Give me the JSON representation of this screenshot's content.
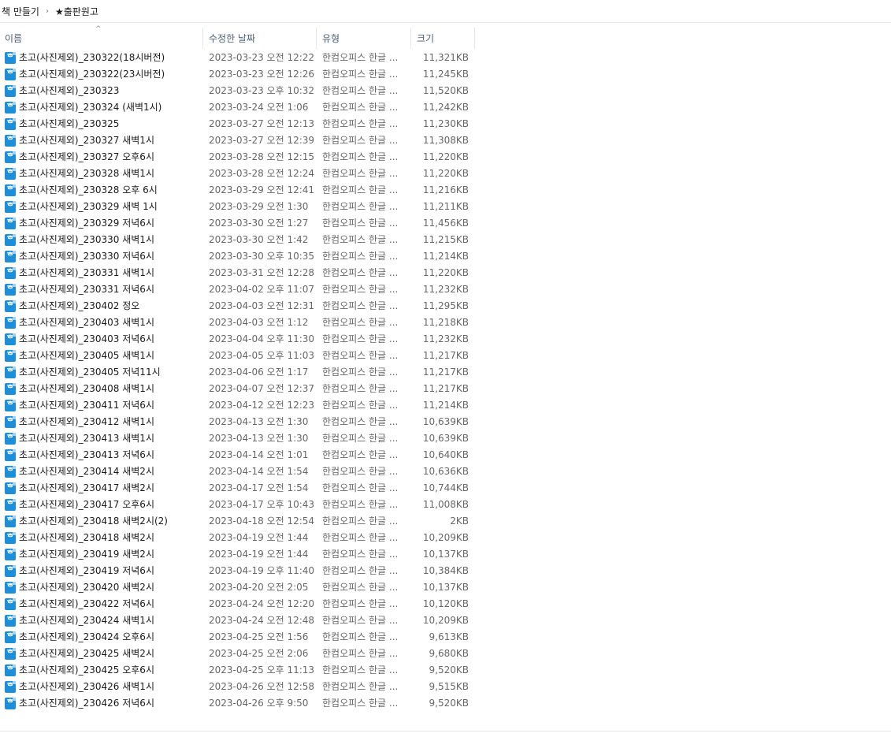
{
  "breadcrumb": {
    "items": [
      "책 만들기",
      "★출판원고"
    ],
    "separator": "›"
  },
  "header": {
    "sort_caret": "^",
    "columns": [
      "이름",
      "수정한 날짜",
      "유형",
      "크기"
    ]
  },
  "files": [
    {
      "name": "초고(사진제외)_230322(18시버전)",
      "date": "2023-03-23 오전 12:22",
      "type": "한컴오피스 한글 ...",
      "size": "11,321KB"
    },
    {
      "name": "초고(사진제외)_230322(23시버전)",
      "date": "2023-03-23 오전 12:26",
      "type": "한컴오피스 한글 ...",
      "size": "11,245KB"
    },
    {
      "name": "초고(사진제외)_230323",
      "date": "2023-03-23 오후 10:32",
      "type": "한컴오피스 한글 ...",
      "size": "11,520KB"
    },
    {
      "name": "초고(사진제외)_230324 (새벽1시)",
      "date": "2023-03-24 오전 1:06",
      "type": "한컴오피스 한글 ...",
      "size": "11,242KB"
    },
    {
      "name": "초고(사진제외)_230325",
      "date": "2023-03-27 오전 12:13",
      "type": "한컴오피스 한글 ...",
      "size": "11,230KB"
    },
    {
      "name": "초고(사진제외)_230327 새벽1시",
      "date": "2023-03-27 오전 12:39",
      "type": "한컴오피스 한글 ...",
      "size": "11,308KB"
    },
    {
      "name": "초고(사진제외)_230327 오후6시",
      "date": "2023-03-28 오전 12:15",
      "type": "한컴오피스 한글 ...",
      "size": "11,220KB"
    },
    {
      "name": "초고(사진제외)_230328 새벽1시",
      "date": "2023-03-28 오전 12:24",
      "type": "한컴오피스 한글 ...",
      "size": "11,220KB"
    },
    {
      "name": "초고(사진제외)_230328 오후 6시",
      "date": "2023-03-29 오전 12:41",
      "type": "한컴오피스 한글 ...",
      "size": "11,216KB"
    },
    {
      "name": "초고(사진제외)_230329 새벽 1시",
      "date": "2023-03-29 오전 1:30",
      "type": "한컴오피스 한글 ...",
      "size": "11,211KB"
    },
    {
      "name": "초고(사진제외)_230329 저녁6시",
      "date": "2023-03-30 오전 1:27",
      "type": "한컴오피스 한글 ...",
      "size": "11,456KB"
    },
    {
      "name": "초고(사진제외)_230330 새벽1시",
      "date": "2023-03-30 오전 1:42",
      "type": "한컴오피스 한글 ...",
      "size": "11,215KB"
    },
    {
      "name": "초고(사진제외)_230330 저녁6시",
      "date": "2023-03-30 오후 10:35",
      "type": "한컴오피스 한글 ...",
      "size": "11,214KB"
    },
    {
      "name": "초고(사진제외)_230331 새벽1시",
      "date": "2023-03-31 오전 12:28",
      "type": "한컴오피스 한글 ...",
      "size": "11,220KB"
    },
    {
      "name": "초고(사진제외)_230331 저녁6시",
      "date": "2023-04-02 오후 11:07",
      "type": "한컴오피스 한글 ...",
      "size": "11,232KB"
    },
    {
      "name": "초고(사진제외)_230402 정오",
      "date": "2023-04-03 오전 12:31",
      "type": "한컴오피스 한글 ...",
      "size": "11,295KB"
    },
    {
      "name": "초고(사진제외)_230403 새벽1시",
      "date": "2023-04-03 오전 1:12",
      "type": "한컴오피스 한글 ...",
      "size": "11,218KB"
    },
    {
      "name": "초고(사진제외)_230403 저녁6시",
      "date": "2023-04-04 오후 11:30",
      "type": "한컴오피스 한글 ...",
      "size": "11,232KB"
    },
    {
      "name": "초고(사진제외)_230405 새벽1시",
      "date": "2023-04-05 오후 11:03",
      "type": "한컴오피스 한글 ...",
      "size": "11,217KB"
    },
    {
      "name": "초고(사진제외)_230405 저녁11시",
      "date": "2023-04-06 오전 1:17",
      "type": "한컴오피스 한글 ...",
      "size": "11,217KB"
    },
    {
      "name": "초고(사진제외)_230408 새벽1시",
      "date": "2023-04-07 오전 12:37",
      "type": "한컴오피스 한글 ...",
      "size": "11,217KB"
    },
    {
      "name": "초고(사진제외)_230411 저녁6시",
      "date": "2023-04-12 오전 12:23",
      "type": "한컴오피스 한글 ...",
      "size": "11,214KB"
    },
    {
      "name": "초고(사진제외)_230412 새벽1시",
      "date": "2023-04-13 오전 1:30",
      "type": "한컴오피스 한글 ...",
      "size": "10,639KB"
    },
    {
      "name": "초고(사진제외)_230413 새벽1시",
      "date": "2023-04-13 오전 1:30",
      "type": "한컴오피스 한글 ...",
      "size": "10,639KB"
    },
    {
      "name": "초고(사진제외)_230413 저녁6시",
      "date": "2023-04-14 오전 1:01",
      "type": "한컴오피스 한글 ...",
      "size": "10,640KB"
    },
    {
      "name": "초고(사진제외)_230414 새벽2시",
      "date": "2023-04-14 오전 1:54",
      "type": "한컴오피스 한글 ...",
      "size": "10,636KB"
    },
    {
      "name": "초고(사진제외)_230417 새벽2시",
      "date": "2023-04-17 오전 1:54",
      "type": "한컴오피스 한글 ...",
      "size": "10,744KB"
    },
    {
      "name": "초고(사진제외)_230417 오후6시",
      "date": "2023-04-17 오후 10:43",
      "type": "한컴오피스 한글 ...",
      "size": "11,008KB"
    },
    {
      "name": "초고(사진제외)_230418 새벽2시(2)",
      "date": "2023-04-18 오전 12:54",
      "type": "한컴오피스 한글 ...",
      "size": "2KB"
    },
    {
      "name": "초고(사진제외)_230418 새벽2시",
      "date": "2023-04-19 오전 1:44",
      "type": "한컴오피스 한글 ...",
      "size": "10,209KB"
    },
    {
      "name": "초고(사진제외)_230419 새벽2시",
      "date": "2023-04-19 오전 1:44",
      "type": "한컴오피스 한글 ...",
      "size": "10,137KB"
    },
    {
      "name": "초고(사진제외)_230419 저녁6시",
      "date": "2023-04-19 오후 11:40",
      "type": "한컴오피스 한글 ...",
      "size": "10,384KB"
    },
    {
      "name": "초고(사진제외)_230420 새벽2시",
      "date": "2023-04-20 오전 2:05",
      "type": "한컴오피스 한글 ...",
      "size": "10,137KB"
    },
    {
      "name": "초고(사진제외)_230422 저녁6시",
      "date": "2023-04-24 오전 12:20",
      "type": "한컴오피스 한글 ...",
      "size": "10,120KB"
    },
    {
      "name": "초고(사진제외)_230424 새벽1시",
      "date": "2023-04-24 오전 12:48",
      "type": "한컴오피스 한글 ...",
      "size": "10,209KB"
    },
    {
      "name": "초고(사진제외)_230424 오후6시",
      "date": "2023-04-25 오전 1:56",
      "type": "한컴오피스 한글 ...",
      "size": "9,613KB"
    },
    {
      "name": "초고(사진제외)_230425 새벽2시",
      "date": "2023-04-25 오전 2:06",
      "type": "한컴오피스 한글 ...",
      "size": "9,680KB"
    },
    {
      "name": "초고(사진제외)_230425 오후6시",
      "date": "2023-04-25 오후 11:13",
      "type": "한컴오피스 한글 ...",
      "size": "9,520KB"
    },
    {
      "name": "초고(사진제외)_230426 새벽1시",
      "date": "2023-04-26 오전 12:58",
      "type": "한컴오피스 한글 ...",
      "size": "9,515KB"
    },
    {
      "name": "초고(사진제외)_230426 저녁6시",
      "date": "2023-04-26 오후 9:50",
      "type": "한컴오피스 한글 ...",
      "size": "9,520KB"
    }
  ]
}
